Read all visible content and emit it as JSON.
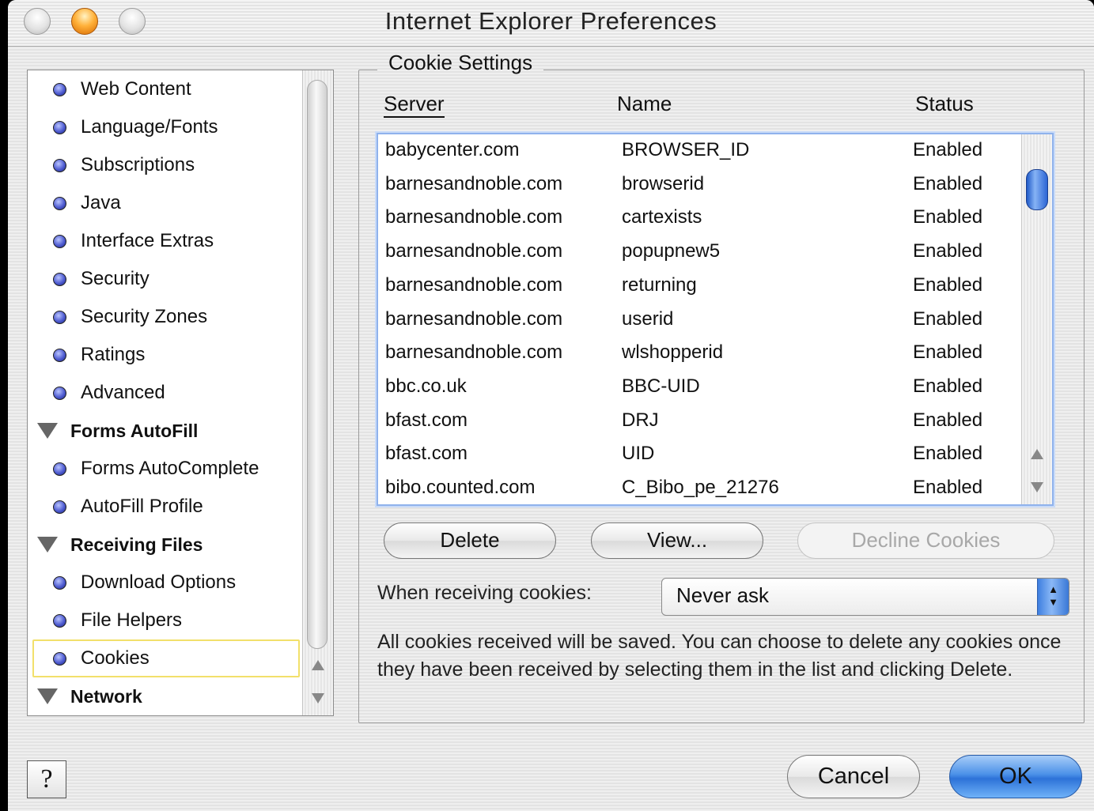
{
  "window": {
    "title": "Internet Explorer Preferences"
  },
  "sidebar": {
    "items": [
      {
        "type": "item",
        "label": "Web Content",
        "name": "sidebar-item-web-content"
      },
      {
        "type": "item",
        "label": "Language/Fonts",
        "name": "sidebar-item-language-fonts"
      },
      {
        "type": "item",
        "label": "Subscriptions",
        "name": "sidebar-item-subscriptions"
      },
      {
        "type": "item",
        "label": "Java",
        "name": "sidebar-item-java"
      },
      {
        "type": "item",
        "label": "Interface Extras",
        "name": "sidebar-item-interface-extras"
      },
      {
        "type": "item",
        "label": "Security",
        "name": "sidebar-item-security"
      },
      {
        "type": "item",
        "label": "Security Zones",
        "name": "sidebar-item-security-zones"
      },
      {
        "type": "item",
        "label": "Ratings",
        "name": "sidebar-item-ratings"
      },
      {
        "type": "item",
        "label": "Advanced",
        "name": "sidebar-item-advanced"
      },
      {
        "type": "group",
        "label": "Forms AutoFill",
        "name": "sidebar-group-forms-autofill"
      },
      {
        "type": "item",
        "label": "Forms AutoComplete",
        "name": "sidebar-item-forms-autocomplete"
      },
      {
        "type": "item",
        "label": "AutoFill Profile",
        "name": "sidebar-item-autofill-profile"
      },
      {
        "type": "group",
        "label": "Receiving Files",
        "name": "sidebar-group-receiving-files"
      },
      {
        "type": "item",
        "label": "Download Options",
        "name": "sidebar-item-download-options"
      },
      {
        "type": "item",
        "label": "File Helpers",
        "name": "sidebar-item-file-helpers"
      },
      {
        "type": "item",
        "label": "Cookies",
        "name": "sidebar-item-cookies",
        "selected": true
      },
      {
        "type": "group",
        "label": "Network",
        "name": "sidebar-group-network"
      }
    ]
  },
  "cookies": {
    "group_title": "Cookie Settings",
    "columns": {
      "server": "Server",
      "name": "Name",
      "status": "Status"
    },
    "rows": [
      {
        "server": "babycenter.com",
        "name": "BROWSER_ID",
        "status": "Enabled"
      },
      {
        "server": "barnesandnoble.com",
        "name": "browserid",
        "status": "Enabled"
      },
      {
        "server": "barnesandnoble.com",
        "name": "cartexists",
        "status": "Enabled"
      },
      {
        "server": "barnesandnoble.com",
        "name": "popupnew5",
        "status": "Enabled"
      },
      {
        "server": "barnesandnoble.com",
        "name": "returning",
        "status": "Enabled"
      },
      {
        "server": "barnesandnoble.com",
        "name": "userid",
        "status": "Enabled"
      },
      {
        "server": "barnesandnoble.com",
        "name": "wlshopperid",
        "status": "Enabled"
      },
      {
        "server": "bbc.co.uk",
        "name": "BBC-UID",
        "status": "Enabled"
      },
      {
        "server": "bfast.com",
        "name": "DRJ",
        "status": "Enabled"
      },
      {
        "server": "bfast.com",
        "name": "UID",
        "status": "Enabled"
      },
      {
        "server": "bibo.counted.com",
        "name": "C_Bibo_pe_21276",
        "status": "Enabled"
      }
    ],
    "buttons": {
      "delete": "Delete",
      "view": "View...",
      "decline": "Decline Cookies"
    },
    "receiving_label": "When receiving cookies:",
    "receiving_value": "Never ask",
    "help_text": "All cookies received will be saved.  You can choose to delete any cookies once they have been received by selecting them in the list and clicking Delete."
  },
  "footer": {
    "help": "?",
    "cancel": "Cancel",
    "ok": "OK"
  },
  "icons": {
    "close": "close-icon",
    "minimize": "minimize-icon",
    "zoom": "zoom-icon",
    "bullet": "bullet-icon",
    "disclosure": "disclosure-triangle-icon",
    "scroll_up": "scroll-up-arrow-icon",
    "scroll_down": "scroll-down-arrow-icon",
    "select_arrows": "popup-arrows-icon"
  },
  "colors": {
    "accent": "#4a90e8",
    "selection_border": "#f2e06b",
    "orange_button": "#ffb13a"
  }
}
